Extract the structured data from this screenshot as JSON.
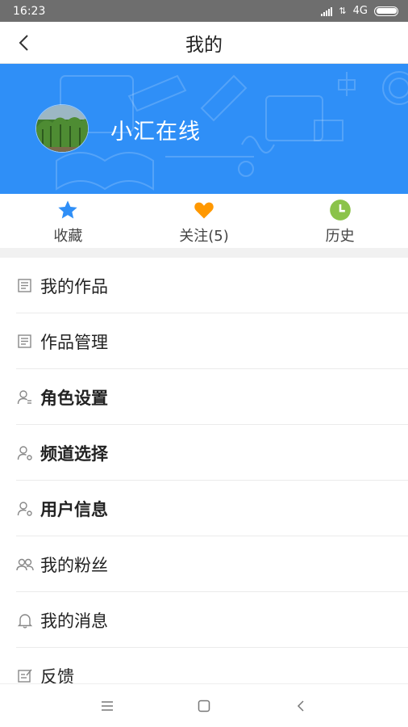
{
  "status_bar": {
    "time": "16:23",
    "network": "4G"
  },
  "header": {
    "title": "我的"
  },
  "profile": {
    "username": "小汇在线",
    "banner_color": "#2f8ff7"
  },
  "quick_actions": [
    {
      "label": "收藏",
      "icon": "star-icon",
      "color": "#2f8ff7"
    },
    {
      "label": "关注(5)",
      "icon": "heart-icon",
      "color": "#ff9800"
    },
    {
      "label": "历史",
      "icon": "clock-icon",
      "color": "#8bc34a"
    }
  ],
  "menu": [
    {
      "label": "我的作品",
      "icon": "document-icon"
    },
    {
      "label": "作品管理",
      "icon": "document-icon"
    },
    {
      "label": "角色设置",
      "icon": "user-settings-icon"
    },
    {
      "label": "频道选择",
      "icon": "user-settings-icon"
    },
    {
      "label": "用户信息",
      "icon": "user-settings-icon"
    },
    {
      "label": "我的粉丝",
      "icon": "users-icon"
    },
    {
      "label": "我的消息",
      "icon": "bell-icon"
    },
    {
      "label": "反馈",
      "icon": "feedback-icon"
    }
  ]
}
